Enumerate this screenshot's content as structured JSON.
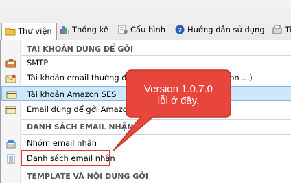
{
  "menubar": {
    "items": [
      {
        "label": "Thư viện",
        "icon": "folder-icon"
      },
      {
        "label": "Thống kê",
        "icon": "bar-chart-icon"
      },
      {
        "label": "Cấu hình",
        "icon": "config-icon"
      },
      {
        "label": "Hướng dẫn sử dụng",
        "icon": "help-icon"
      },
      {
        "label": "Ti",
        "icon": "phone-icon"
      }
    ]
  },
  "menu": {
    "sections": [
      {
        "header": "TÀI KHOẢN DÙNG ĐỂ GỞI"
      },
      {
        "header": "DANH SÁCH EMAIL NHẬN"
      },
      {
        "header": "TEMPLATE VÀ NỘI DUNG GỞI"
      }
    ],
    "items": [
      {
        "label": "SMTP",
        "icon": "smtp-icon"
      },
      {
        "label": "Tài khoản email thường để gởi (Gmail, Yahoo, amazon ...)",
        "icon": "mail-icon"
      },
      {
        "label": "Tài khoản Amazon SES",
        "icon": "card-icon"
      },
      {
        "label": "Email dùng để gởi Amazon",
        "icon": "card-icon"
      },
      {
        "label": "Nhóm email nhận",
        "icon": "group-icon"
      },
      {
        "label": "Danh sách email nhận",
        "icon": "list-icon"
      }
    ]
  },
  "callout": {
    "line1": "Version 1.0.7.0",
    "line2": "lỗi ở đây.",
    "color": "#e8453c"
  }
}
